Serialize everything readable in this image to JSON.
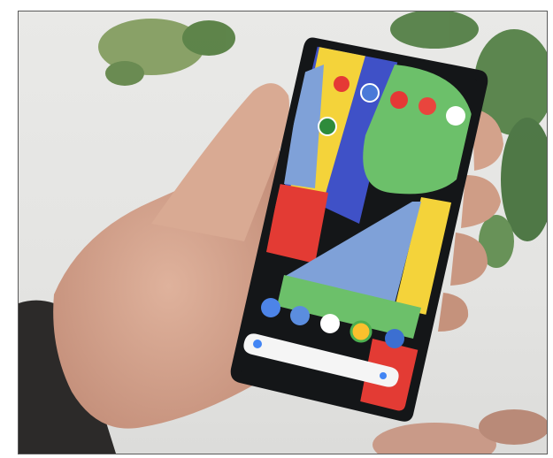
{
  "photo": {
    "subject": "",
    "colors": {
      "background": "#e6e6e4",
      "skin": "#d7aa95",
      "phone_body": "#141618",
      "blue": "#3f51c7",
      "light_blue": "#7fa1d8",
      "yellow": "#f4d33a",
      "green": "#6cc06a",
      "red": "#e33b34",
      "sleeve": "#2c2a29"
    }
  },
  "phone_screen": {
    "search_hint": "",
    "home_icons": [
      "youtube-icon",
      "clock-icon",
      "camera-icon",
      "maps-icon",
      "photos-icon",
      "play-store-icon",
      "phone-icon",
      "messages-icon",
      "gmail-icon",
      "chrome-icon"
    ]
  }
}
